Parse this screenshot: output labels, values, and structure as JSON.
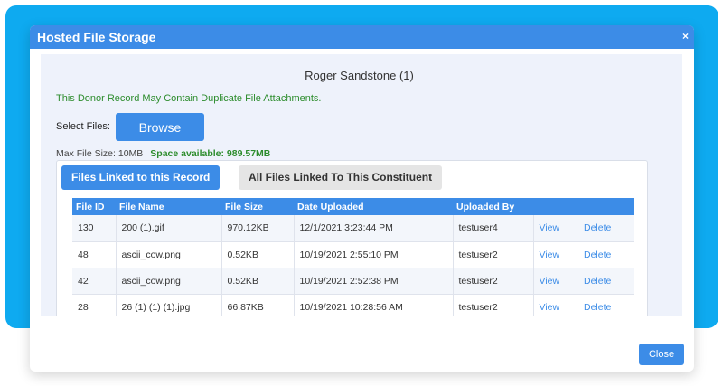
{
  "modal": {
    "title": "Hosted File Storage",
    "close_x": "×",
    "close_label": "Close"
  },
  "record": {
    "name": "Roger Sandstone (1)",
    "duplicate_warning": "This Donor Record May Contain Duplicate File Attachments."
  },
  "upload": {
    "select_label": "Select Files:",
    "browse_label": "Browse",
    "max_size": "Max File Size: 10MB",
    "space_available": "Space available: 989.57MB"
  },
  "tabs": [
    {
      "label": "Files Linked to this Record",
      "active": true
    },
    {
      "label": "All Files Linked To This Constituent",
      "active": false
    }
  ],
  "table": {
    "headers": [
      "File ID",
      "File Name",
      "File Size",
      "Date Uploaded",
      "Uploaded By",
      "",
      ""
    ],
    "rows": [
      {
        "id": "130",
        "name": "200 (1).gif",
        "size": "970.12KB",
        "date": "12/1/2021 3:23:44 PM",
        "by": "testuser4",
        "view": "View",
        "delete": "Delete"
      },
      {
        "id": "48",
        "name": "ascii_cow.png",
        "size": "0.52KB",
        "date": "10/19/2021 2:55:10 PM",
        "by": "testuser2",
        "view": "View",
        "delete": "Delete"
      },
      {
        "id": "42",
        "name": "ascii_cow.png",
        "size": "0.52KB",
        "date": "10/19/2021 2:52:38 PM",
        "by": "testuser2",
        "view": "View",
        "delete": "Delete"
      },
      {
        "id": "28",
        "name": "26 (1) (1) (1).jpg",
        "size": "66.87KB",
        "date": "10/19/2021 10:28:56 AM",
        "by": "testuser2",
        "view": "View",
        "delete": "Delete"
      }
    ]
  },
  "colors": {
    "background": "#0eaaf0",
    "primary": "#3c8ce7",
    "success_text": "#2c8c2c"
  }
}
